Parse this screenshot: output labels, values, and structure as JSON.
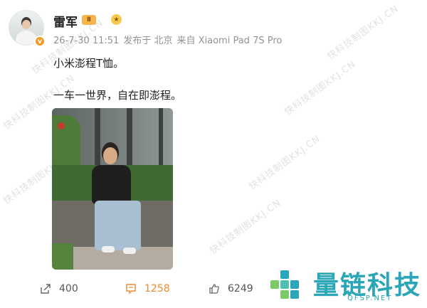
{
  "post": {
    "author": "雷军",
    "crown_level": "Ⅱ",
    "verified_mark": "v",
    "timestamp": "26-7-30 11:51",
    "location": "发布于 北京",
    "device": "来自 Xiaomi Pad 7S Pro",
    "line1": "小米澎程T恤。",
    "line2": "一车一世界，自在即澎程。"
  },
  "actions": {
    "share_count": "400",
    "comment_count": "1258",
    "like_count": "6249"
  },
  "watermark": {
    "text": "快科技制图KKJ.CN"
  },
  "logo": {
    "title": "量链科技",
    "subtitle": "QFSP.NET",
    "color": "#2aa6b8"
  },
  "colors": {
    "accent_orange": "#f08a2e",
    "meta_gray": "#939393"
  },
  "icons": [
    "avatar",
    "verified-badge",
    "crown-badge",
    "medal-icon",
    "share-icon",
    "comment-icon",
    "like-icon"
  ]
}
